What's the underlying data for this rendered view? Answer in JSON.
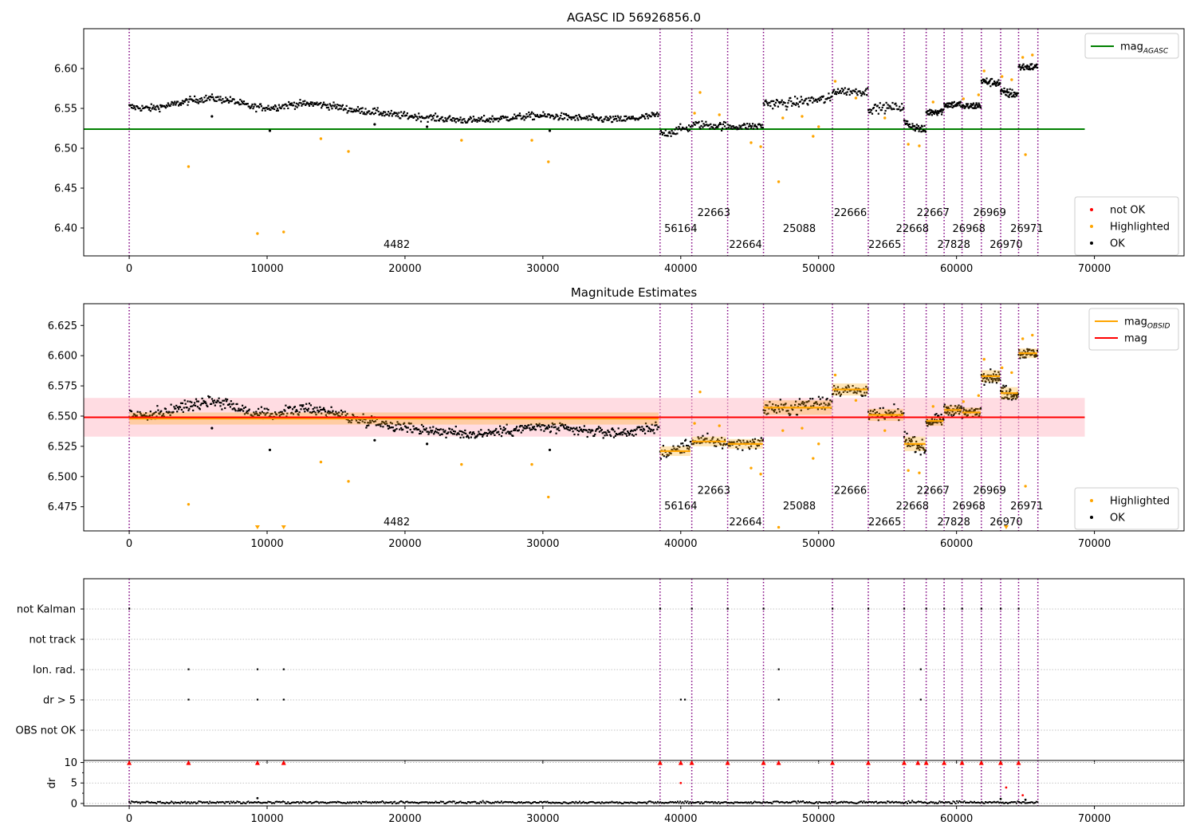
{
  "figure": {
    "background": "#ffffff"
  },
  "colors": {
    "ok": "#000000",
    "highlighted": "#ffa500",
    "not_ok": "#ff0000",
    "mag_agasc_line": "#008000",
    "mag_obsid_line": "#ffa500",
    "mag_line": "#ff0000",
    "mag_band": "#ffc0cb",
    "obsid_divider": "#800080",
    "grid": "#b0b0b0"
  },
  "chart_data": [
    {
      "type": "scatter",
      "title": "AGASC ID 56926856.0",
      "xlabel": "",
      "ylabel": "",
      "xlim": [
        -3300,
        76500
      ],
      "ylim": [
        6.365,
        6.65
      ],
      "xticks": [
        0,
        10000,
        20000,
        30000,
        40000,
        50000,
        60000,
        70000
      ],
      "xtick_labels": [
        "0",
        "10000",
        "20000",
        "30000",
        "40000",
        "50000",
        "60000",
        "70000"
      ],
      "yticks": [
        6.4,
        6.45,
        6.5,
        6.55,
        6.6
      ],
      "ytick_labels": [
        "6.40",
        "6.45",
        "6.50",
        "6.55",
        "6.60"
      ],
      "grid": false,
      "legends": [
        {
          "position": "top-right",
          "entries": [
            {
              "label": "mag",
              "sub": "AGASC",
              "kind": "line",
              "color": "#008000"
            }
          ]
        },
        {
          "position": "bottom-right",
          "entries": [
            {
              "label": "not OK",
              "kind": "dot",
              "color": "#ff0000"
            },
            {
              "label": "Highlighted",
              "kind": "dot",
              "color": "#ffa500"
            },
            {
              "label": "OK",
              "kind": "dot",
              "color": "#000000"
            }
          ]
        }
      ],
      "reference_lines": [
        {
          "name": "mag_AGASC",
          "y": 6.524,
          "x_range": [
            -3300,
            69300
          ],
          "color": "#008000"
        }
      ],
      "obsid_boundaries": [
        0,
        38500,
        40800,
        43400,
        46000,
        51000,
        53600,
        56200,
        57800,
        59100,
        60400,
        61800,
        63200,
        64500,
        65900
      ],
      "obsid_labels": [
        {
          "text": "4482",
          "x": 19400,
          "y": 6.38
        },
        {
          "text": "56164",
          "x": 40000,
          "y": 6.4
        },
        {
          "text": "22663",
          "x": 42400,
          "y": 6.42
        },
        {
          "text": "22664",
          "x": 44700,
          "y": 6.38
        },
        {
          "text": "25088",
          "x": 48600,
          "y": 6.4
        },
        {
          "text": "22666",
          "x": 52300,
          "y": 6.42
        },
        {
          "text": "22665",
          "x": 54800,
          "y": 6.38
        },
        {
          "text": "22668",
          "x": 56800,
          "y": 6.4
        },
        {
          "text": "22667",
          "x": 58300,
          "y": 6.42
        },
        {
          "text": "27828",
          "x": 59800,
          "y": 6.38
        },
        {
          "text": "26968",
          "x": 60900,
          "y": 6.4
        },
        {
          "text": "26969",
          "x": 62400,
          "y": 6.42
        },
        {
          "text": "26970",
          "x": 63600,
          "y": 6.38
        },
        {
          "text": "26971",
          "x": 65100,
          "y": 6.4
        }
      ],
      "ok_segments": [
        {
          "x": [
            0,
            38400
          ],
          "y": [
            6.552,
            6.55,
            6.554,
            6.56,
            6.563,
            6.56,
            6.552,
            6.551,
            6.555,
            6.556,
            6.553,
            6.548,
            6.546,
            6.542,
            6.54,
            6.538,
            6.536,
            6.535,
            6.537,
            6.539,
            6.541,
            6.54,
            6.538,
            6.537,
            6.536,
            6.538,
            6.542
          ],
          "spread": 0.007
        },
        {
          "x": [
            38500,
            40700
          ],
          "y": [
            6.518,
            6.52,
            6.524,
            6.526
          ],
          "spread": 0.008
        },
        {
          "x": [
            40800,
            43300
          ],
          "y": [
            6.53,
            6.528
          ],
          "spread": 0.008
        },
        {
          "x": [
            43400,
            45950
          ],
          "y": [
            6.527,
            6.528
          ],
          "spread": 0.007
        },
        {
          "x": [
            46000,
            50950
          ],
          "y": [
            6.557,
            6.556,
            6.56,
            6.562
          ],
          "spread": 0.01
        },
        {
          "x": [
            51000,
            53550
          ],
          "y": [
            6.572,
            6.571
          ],
          "spread": 0.008
        },
        {
          "x": [
            53600,
            56150
          ],
          "y": [
            6.55,
            6.552
          ],
          "spread": 0.009
        },
        {
          "x": [
            56200,
            57750
          ],
          "y": [
            6.532,
            6.522
          ],
          "spread": 0.008
        },
        {
          "x": [
            57800,
            59050
          ],
          "y": [
            6.545,
            6.547
          ],
          "spread": 0.007
        },
        {
          "x": [
            59100,
            60350
          ],
          "y": [
            6.555,
            6.555
          ],
          "spread": 0.007
        },
        {
          "x": [
            60400,
            61750
          ],
          "y": [
            6.552,
            6.554
          ],
          "spread": 0.007
        },
        {
          "x": [
            61800,
            63150
          ],
          "y": [
            6.584,
            6.582
          ],
          "spread": 0.008
        },
        {
          "x": [
            63200,
            64450
          ],
          "y": [
            6.57,
            6.568
          ],
          "spread": 0.009
        },
        {
          "x": [
            64500,
            65850
          ],
          "y": [
            6.602,
            6.602
          ],
          "spread": 0.007
        }
      ],
      "ok_outliers": [
        [
          6000,
          6.54
        ],
        [
          10200,
          6.522
        ],
        [
          17800,
          6.53
        ],
        [
          21600,
          6.527
        ],
        [
          30500,
          6.522
        ]
      ],
      "highlighted_points": [
        [
          4300,
          6.477
        ],
        [
          9300,
          6.393
        ],
        [
          11200,
          6.395
        ],
        [
          13900,
          6.512
        ],
        [
          15900,
          6.496
        ],
        [
          24100,
          6.51
        ],
        [
          29200,
          6.51
        ],
        [
          30400,
          6.483
        ],
        [
          41400,
          6.57
        ],
        [
          41000,
          6.544
        ],
        [
          42800,
          6.542
        ],
        [
          45100,
          6.507
        ],
        [
          45800,
          6.502
        ],
        [
          47100,
          6.458
        ],
        [
          47400,
          6.538
        ],
        [
          48800,
          6.54
        ],
        [
          49600,
          6.515
        ],
        [
          50000,
          6.527
        ],
        [
          51200,
          6.584
        ],
        [
          52700,
          6.563
        ],
        [
          54800,
          6.538
        ],
        [
          56500,
          6.505
        ],
        [
          57300,
          6.503
        ],
        [
          58300,
          6.558
        ],
        [
          60500,
          6.562
        ],
        [
          61600,
          6.567
        ],
        [
          62000,
          6.597
        ],
        [
          63300,
          6.59
        ],
        [
          64000,
          6.586
        ],
        [
          64800,
          6.614
        ],
        [
          65000,
          6.492
        ],
        [
          65500,
          6.617
        ]
      ],
      "not_ok_points": []
    },
    {
      "type": "scatter",
      "title": "Magnitude Estimates",
      "xlabel": "",
      "ylabel": "",
      "xlim": [
        -3300,
        76500
      ],
      "ylim": [
        6.455,
        6.643
      ],
      "xticks": [
        0,
        10000,
        20000,
        30000,
        40000,
        50000,
        60000,
        70000
      ],
      "xtick_labels": [
        "0",
        "10000",
        "20000",
        "30000",
        "40000",
        "50000",
        "60000",
        "70000"
      ],
      "yticks": [
        6.475,
        6.5,
        6.525,
        6.55,
        6.575,
        6.6,
        6.625
      ],
      "ytick_labels": [
        "6.475",
        "6.500",
        "6.525",
        "6.550",
        "6.575",
        "6.600",
        "6.625"
      ],
      "grid": false,
      "legends": [
        {
          "position": "top-right",
          "entries": [
            {
              "label": "mag",
              "sub": "OBSID",
              "kind": "line",
              "color": "#ffa500"
            },
            {
              "label": "mag",
              "kind": "line",
              "color": "#ff0000"
            }
          ]
        },
        {
          "position": "bottom-right",
          "entries": [
            {
              "label": "Highlighted",
              "kind": "dot",
              "color": "#ffa500"
            },
            {
              "label": "OK",
              "kind": "dot",
              "color": "#000000"
            }
          ]
        }
      ],
      "mag": {
        "y": 6.549,
        "band": [
          6.533,
          6.565
        ],
        "x_range": [
          -3300,
          69300
        ]
      },
      "obsid_mags": [
        {
          "x": [
            0,
            38400
          ],
          "y": 6.548,
          "band": [
            6.543,
            6.553
          ]
        },
        {
          "x": [
            38500,
            40700
          ],
          "y": 6.521,
          "band": [
            6.517,
            6.525
          ]
        },
        {
          "x": [
            40800,
            43300
          ],
          "y": 6.529,
          "band": [
            6.525,
            6.533
          ]
        },
        {
          "x": [
            43400,
            45950
          ],
          "y": 6.527,
          "band": [
            6.523,
            6.531
          ]
        },
        {
          "x": [
            46000,
            50950
          ],
          "y": 6.557,
          "band": [
            6.551,
            6.563
          ]
        },
        {
          "x": [
            51000,
            53550
          ],
          "y": 6.572,
          "band": [
            6.567,
            6.577
          ]
        },
        {
          "x": [
            53600,
            56150
          ],
          "y": 6.551,
          "band": [
            6.546,
            6.556
          ]
        },
        {
          "x": [
            56200,
            57750
          ],
          "y": 6.527,
          "band": [
            6.521,
            6.533
          ]
        },
        {
          "x": [
            57800,
            59050
          ],
          "y": 6.546,
          "band": [
            6.542,
            6.55
          ]
        },
        {
          "x": [
            59100,
            60350
          ],
          "y": 6.555,
          "band": [
            6.551,
            6.559
          ]
        },
        {
          "x": [
            60400,
            61750
          ],
          "y": 6.553,
          "band": [
            6.549,
            6.557
          ]
        },
        {
          "x": [
            61800,
            63150
          ],
          "y": 6.583,
          "band": [
            6.578,
            6.588
          ]
        },
        {
          "x": [
            63200,
            64450
          ],
          "y": 6.569,
          "band": [
            6.564,
            6.574
          ]
        },
        {
          "x": [
            64500,
            65850
          ],
          "y": 6.602,
          "band": [
            6.598,
            6.606
          ]
        }
      ],
      "obsid_labels": [
        {
          "text": "4482",
          "x": 19400,
          "y": 6.463
        },
        {
          "text": "56164",
          "x": 40000,
          "y": 6.476
        },
        {
          "text": "22663",
          "x": 42400,
          "y": 6.489
        },
        {
          "text": "22664",
          "x": 44700,
          "y": 6.463
        },
        {
          "text": "25088",
          "x": 48600,
          "y": 6.476
        },
        {
          "text": "22666",
          "x": 52300,
          "y": 6.489
        },
        {
          "text": "22665",
          "x": 54800,
          "y": 6.463
        },
        {
          "text": "22668",
          "x": 56800,
          "y": 6.476
        },
        {
          "text": "22667",
          "x": 58300,
          "y": 6.489
        },
        {
          "text": "27828",
          "x": 59800,
          "y": 6.463
        },
        {
          "text": "26968",
          "x": 60900,
          "y": 6.476
        },
        {
          "text": "26969",
          "x": 62400,
          "y": 6.489
        },
        {
          "text": "26970",
          "x": 63600,
          "y": 6.463
        },
        {
          "text": "26971",
          "x": 65100,
          "y": 6.476
        }
      ],
      "off_scale_markers": [
        [
          9300,
          6.457
        ],
        [
          11200,
          6.457
        ],
        [
          63600,
          6.457
        ]
      ]
    },
    {
      "type": "scatter",
      "title": "",
      "xlabel": "",
      "ylabel": "",
      "xlim": [
        -3300,
        76500
      ],
      "xticks": [
        0,
        10000,
        20000,
        30000,
        40000,
        50000,
        60000,
        70000
      ],
      "xtick_labels": [
        "0",
        "10000",
        "20000",
        "30000",
        "40000",
        "50000",
        "60000",
        "70000"
      ],
      "flag_rows": [
        "not Kalman",
        "not track",
        "Ion. rad.",
        "dr > 5",
        "OBS not OK"
      ],
      "flags": {
        "not Kalman": [
          0,
          38500,
          40800,
          43400,
          46000,
          51000,
          53600,
          56200,
          57800,
          59100,
          60400,
          61800,
          63200,
          64500
        ],
        "not track": [],
        "Ion. rad.": [
          4300,
          9300,
          11200,
          47100,
          57400
        ],
        "dr > 5": [
          4300,
          9300,
          11200,
          40000,
          40300,
          47100,
          57400
        ],
        "OBS not OK": []
      },
      "grid": true
    },
    {
      "type": "scatter",
      "title": "",
      "xlabel": "",
      "ylabel": "dr",
      "xlim": [
        -3300,
        76500
      ],
      "ylim": [
        -0.6,
        10.5
      ],
      "xticks": [
        0,
        10000,
        20000,
        30000,
        40000,
        50000,
        60000,
        70000
      ],
      "xtick_labels": [
        "0",
        "10000",
        "20000",
        "30000",
        "40000",
        "50000",
        "60000",
        "70000"
      ],
      "yticks": [
        0,
        5,
        10
      ],
      "ytick_labels": [
        "0",
        "5",
        "10"
      ],
      "grid": true,
      "dr_baseline": {
        "x": [
          0,
          65900
        ],
        "y": 0.25,
        "spread": 0.4
      },
      "clipped_markers": [
        0,
        4300,
        9300,
        11200,
        38500,
        40000,
        40800,
        43400,
        46000,
        47100,
        51000,
        53600,
        56200,
        57200,
        57800,
        59100,
        60400,
        61800,
        63200,
        64500
      ],
      "red_points": [
        [
          40000,
          5.0
        ],
        [
          63600,
          3.9
        ],
        [
          64800,
          2.0
        ]
      ],
      "black_points": [
        [
          9300,
          1.3
        ],
        [
          63200,
          1.1
        ],
        [
          65000,
          0.9
        ]
      ]
    }
  ]
}
